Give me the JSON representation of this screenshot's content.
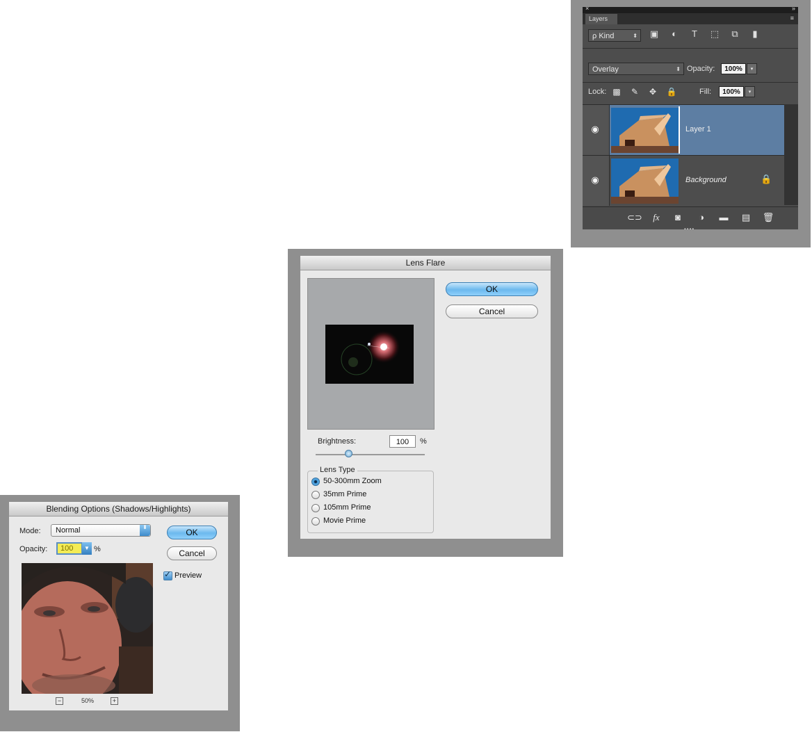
{
  "layers_panel": {
    "close_glyph": "×",
    "collapse_glyph": "»",
    "tab_label": "Layers",
    "panel_menu_glyph": "≡",
    "filter": {
      "kind_label": "ρ Kind",
      "arrow": "⬍"
    },
    "filter_icons": [
      {
        "icon": "image-filter-icon",
        "glyph": "▣"
      },
      {
        "icon": "adjustment-filter-icon",
        "glyph": "◐"
      },
      {
        "icon": "type-filter-icon",
        "glyph": "T"
      },
      {
        "icon": "shape-filter-icon",
        "glyph": "⬚"
      },
      {
        "icon": "smart-object-filter-icon",
        "glyph": "⧉"
      },
      {
        "icon": "filter-toggle-icon",
        "glyph": "▮"
      }
    ],
    "blend_mode": "Overlay",
    "blend_arrow": "⬍",
    "opacity_label": "Opacity:",
    "opacity_value": "100%",
    "fill_label": "Fill:",
    "fill_value": "100%",
    "dropdown_glyph": "▾",
    "lock_label": "Lock:",
    "lock_icons": [
      {
        "icon": "lock-transparent-pixels-icon",
        "glyph": "▩"
      },
      {
        "icon": "lock-image-pixels-icon",
        "glyph": "✎"
      },
      {
        "icon": "lock-position-icon",
        "glyph": "✥"
      },
      {
        "icon": "lock-all-icon",
        "glyph": "🔒"
      }
    ],
    "layers": [
      {
        "name": "Layer 1",
        "visible_glyph": "◉"
      },
      {
        "name": "Background",
        "visible_glyph": "◉",
        "lock_glyph": "🔒"
      }
    ],
    "bottom_icons": [
      {
        "icon": "link-layers-icon",
        "glyph": "⊂⊃"
      },
      {
        "icon": "fx-icon",
        "glyph": "fx"
      },
      {
        "icon": "add-mask-icon",
        "glyph": "◙"
      },
      {
        "icon": "new-adjustment-layer-icon",
        "glyph": "◑"
      },
      {
        "icon": "new-group-icon",
        "glyph": "▬"
      },
      {
        "icon": "new-layer-icon",
        "glyph": "▤"
      },
      {
        "icon": "delete-layer-icon",
        "glyph": "🗑"
      }
    ],
    "grip": "••••"
  },
  "lens_flare": {
    "title": "Lens Flare",
    "ok_label": "OK",
    "cancel_label": "Cancel",
    "brightness_label": "Brightness:",
    "brightness_value": "100",
    "brightness_unit": "%",
    "brightness_slider_fraction": 0.3,
    "lens_type_label": "Lens Type",
    "lens_types": [
      {
        "label": "50-300mm Zoom",
        "selected": true
      },
      {
        "label": "35mm Prime",
        "selected": false
      },
      {
        "label": "105mm Prime",
        "selected": false
      },
      {
        "label": "Movie Prime",
        "selected": false
      }
    ]
  },
  "blending_options": {
    "title": "Blending Options (Shadows/Highlights)",
    "mode_label": "Mode:",
    "mode_value": "Normal",
    "mode_stepper": "⬍",
    "opacity_label": "Opacity:",
    "opacity_value": "100",
    "opacity_drop": "▼",
    "opacity_unit": "%",
    "ok_label": "OK",
    "cancel_label": "Cancel",
    "preview_label": "Preview",
    "preview_checked": true,
    "zoom_out_glyph": "−",
    "zoom_in_glyph": "+",
    "zoom_value": "50%"
  },
  "colors": {
    "selected_layer": "#5d7ea3",
    "panel_dark": "#4d4d4d",
    "dialog_bg": "#e9e9e9",
    "frame_gray": "#8f8f8f",
    "aqua_blue": "#6cb9ee",
    "opacity_highlight": "#f4ec55"
  }
}
